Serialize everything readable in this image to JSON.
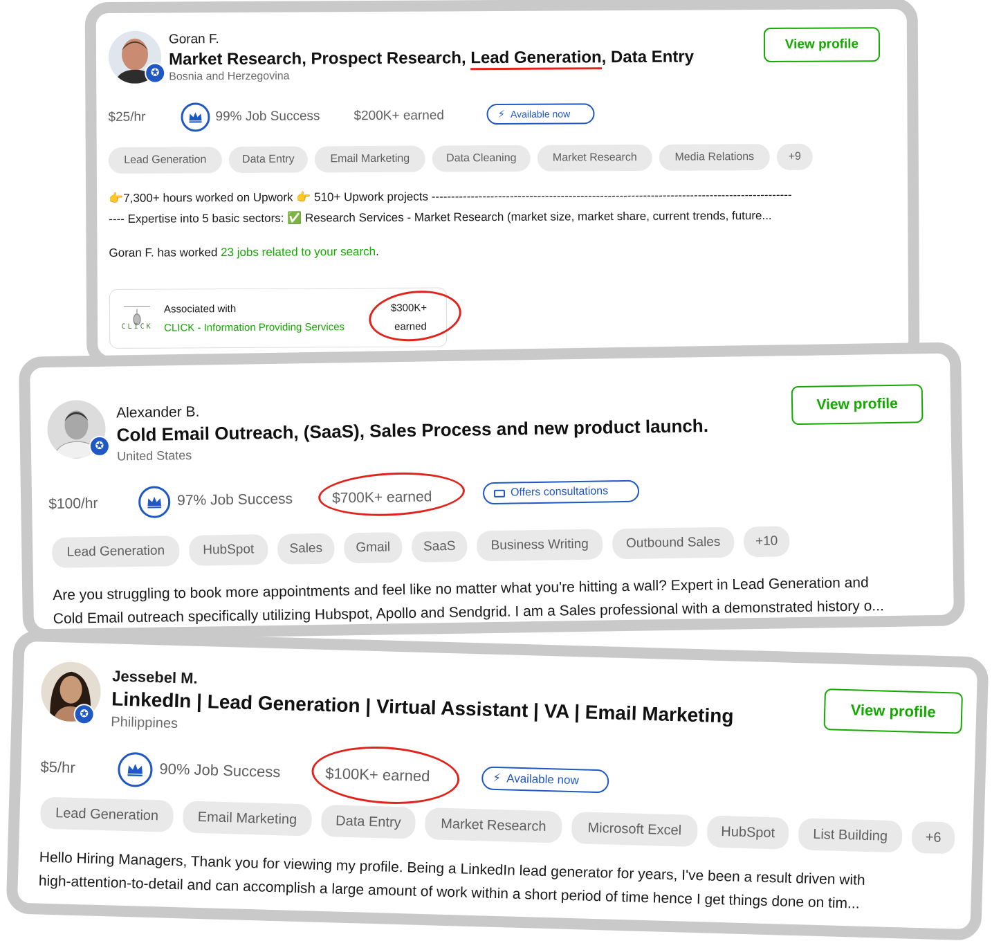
{
  "colors": {
    "accent_green": "#14a800",
    "accent_blue": "#1f57c3",
    "highlight_red": "#e0241b",
    "card_border": "#c9c9c9",
    "skill_bg": "#e9e9e9"
  },
  "cards": [
    {
      "name": "Goran F.",
      "title_parts": [
        "Market Research, Prospect Research, ",
        "Lead Generation",
        ", Data Entry"
      ],
      "location": "Bosnia and Herzegovina",
      "view_profile": "View profile",
      "rate": "$25/hr",
      "job_success": "99% Job Success",
      "earned": "$200K+ earned",
      "status": {
        "label": "Available now",
        "icon": "lightning-icon"
      },
      "skills": [
        "Lead Generation",
        "Data Entry",
        "Email Marketing",
        "Data Cleaning",
        "Market Research",
        "Media Relations",
        "+9"
      ],
      "desc_line1": "👉7,300+ hours worked on Upwork 👉 510+ Upwork projects --------------------------------------------------------------------------------------------",
      "desc_line2": "---- Expertise into 5 basic sectors: ✅ Research Services - Market Research (market size, market share, current trends, future...",
      "worked_prefix": "Goran F. has worked ",
      "worked_link": "23 jobs related to your search",
      "worked_suffix": ".",
      "association": {
        "label": "Associated with",
        "agency": "CLICK - Information Providing Services",
        "logo_text": "CLICK",
        "earned_amount": "$300K+",
        "earned_label": "earned"
      }
    },
    {
      "name": "Alexander B.",
      "title": "Cold Email Outreach, (SaaS), Sales Process and new product launch.",
      "location": "United States",
      "view_profile": "View profile",
      "rate": "$100/hr",
      "job_success": "97% Job Success",
      "earned": "$700K+ earned",
      "status": {
        "label": "Offers consultations",
        "icon": "video-camera-icon"
      },
      "skills": [
        "Lead Generation",
        "HubSpot",
        "Sales",
        "Gmail",
        "SaaS",
        "Business Writing",
        "Outbound Sales",
        "+10"
      ],
      "desc_line1": "Are you struggling to book more appointments and feel like no matter what you're hitting a wall? Expert in Lead Generation and",
      "desc_line2": "Cold Email outreach specifically utilizing Hubspot, Apollo and Sendgrid. I am a Sales professional with a demonstrated history o..."
    },
    {
      "name": "Jessebel M.",
      "title": "LinkedIn | Lead Generation | Virtual Assistant | VA | Email Marketing",
      "location": "Philippines",
      "view_profile": "View profile",
      "rate": "$5/hr",
      "job_success": "90% Job Success",
      "earned": "$100K+ earned",
      "status": {
        "label": "Available now",
        "icon": "lightning-icon"
      },
      "skills": [
        "Lead Generation",
        "Email Marketing",
        "Data Entry",
        "Market Research",
        "Microsoft Excel",
        "HubSpot",
        "List Building",
        "+6"
      ],
      "desc_line1": "Hello Hiring Managers, Thank you for viewing my profile. Being a LinkedIn lead generator for years, I've been a result driven with",
      "desc_line2": "high-attention-to-detail and can accomplish a large amount of work within a short period of time hence I get things done on tim..."
    }
  ]
}
